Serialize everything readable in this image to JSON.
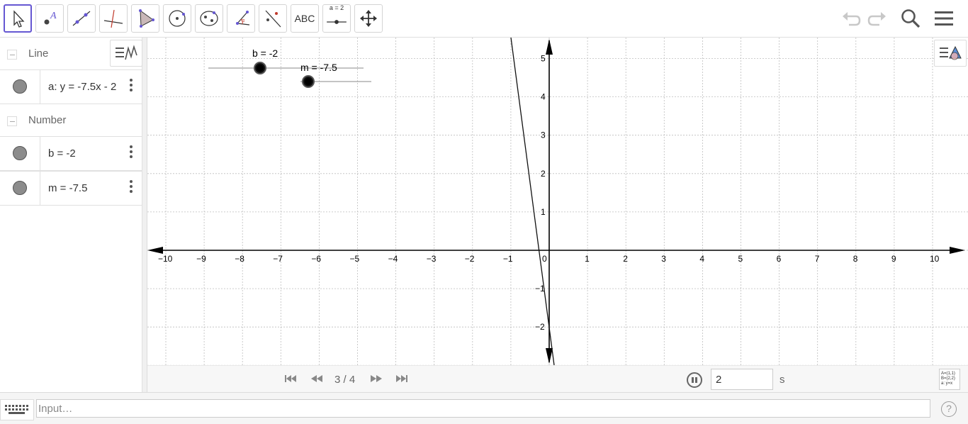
{
  "toolbar": {
    "tools": [
      {
        "name": "move-tool",
        "label": ""
      },
      {
        "name": "point-tool",
        "label": ""
      },
      {
        "name": "line-tool",
        "label": ""
      },
      {
        "name": "perpendicular-line-tool",
        "label": ""
      },
      {
        "name": "polygon-tool",
        "label": ""
      },
      {
        "name": "circle-tool",
        "label": ""
      },
      {
        "name": "ellipse-tool",
        "label": ""
      },
      {
        "name": "angle-tool",
        "label": ""
      },
      {
        "name": "reflect-tool",
        "label": ""
      },
      {
        "name": "text-tool",
        "label": "ABC"
      },
      {
        "name": "slider-tool",
        "label": "a = 2"
      },
      {
        "name": "move-graphics-tool",
        "label": ""
      }
    ]
  },
  "algebra": {
    "categories": [
      {
        "label": "Line"
      },
      {
        "label": "Number"
      }
    ],
    "items": [
      {
        "text": "a: y = -7.5x - 2"
      },
      {
        "text": "b = -2"
      },
      {
        "text": "m = -7.5"
      }
    ]
  },
  "graphics": {
    "sliders": [
      {
        "label": "b = -2"
      },
      {
        "label": "m = -7.5"
      }
    ],
    "x_ticks": [
      "−10",
      "−9",
      "−8",
      "−7",
      "−6",
      "−5",
      "−4",
      "−3",
      "−2",
      "−1",
      "0",
      "1",
      "2",
      "3",
      "4",
      "5",
      "6",
      "7",
      "8",
      "9",
      "10"
    ],
    "y_ticks": [
      "5",
      "4",
      "3",
      "2",
      "1",
      "−1",
      "−2"
    ]
  },
  "playbar": {
    "counter": "3 / 4",
    "speed_value": "2",
    "speed_unit": "s",
    "format_button": "A=(1,1) B=(2,2) a: y=x"
  },
  "inputbar": {
    "placeholder": "Input…"
  },
  "colors": {
    "accent": "#6557d2",
    "grid": "#bdbdbd",
    "axis": "#000000"
  }
}
